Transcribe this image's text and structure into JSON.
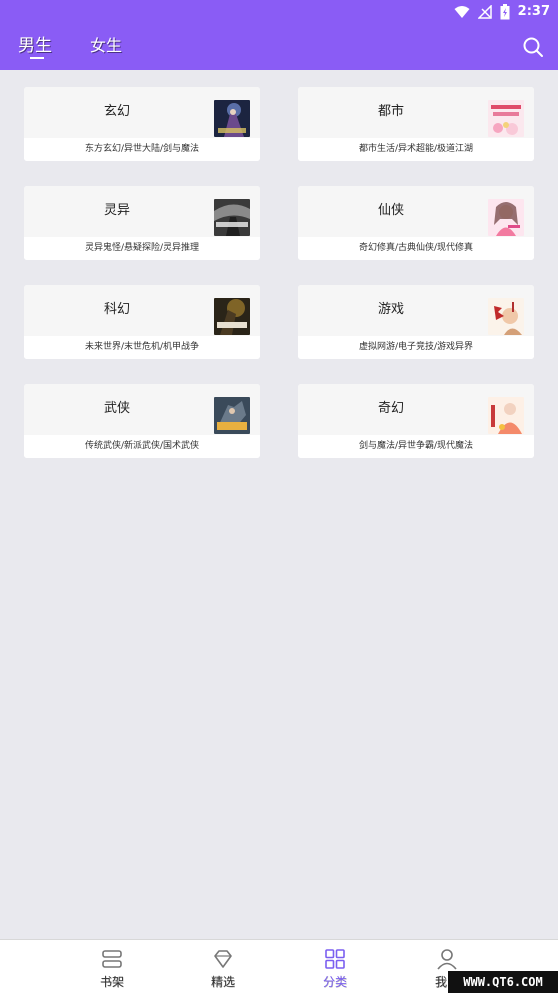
{
  "status_bar": {
    "time": "2:37"
  },
  "header": {
    "tabs": [
      {
        "label": "男生",
        "active": true
      },
      {
        "label": "女生",
        "active": false
      }
    ],
    "accent_color": "#8a5cf5"
  },
  "categories": [
    {
      "title": "玄幻",
      "subtitle": "东方玄幻/异世大陆/剑与魔法"
    },
    {
      "title": "都市",
      "subtitle": "都市生活/异术超能/极道江湖"
    },
    {
      "title": "灵异",
      "subtitle": "灵异鬼怪/悬疑探险/灵异推理"
    },
    {
      "title": "仙侠",
      "subtitle": "奇幻修真/古典仙侠/现代修真"
    },
    {
      "title": "科幻",
      "subtitle": "未来世界/末世危机/机甲战争"
    },
    {
      "title": "游戏",
      "subtitle": "虚拟网游/电子竞技/游戏异界"
    },
    {
      "title": "武侠",
      "subtitle": "传统武侠/新派武侠/国术武侠"
    },
    {
      "title": "奇幻",
      "subtitle": "剑与魔法/异世争霸/现代魔法"
    }
  ],
  "bottom_nav": {
    "items": [
      {
        "label": "书架",
        "icon": "bookshelf-icon"
      },
      {
        "label": "精选",
        "icon": "diamond-icon"
      },
      {
        "label": "分类",
        "icon": "grid-icon",
        "active": true
      },
      {
        "label": "我的",
        "icon": "user-icon"
      }
    ],
    "active_color": "#7b5ff0"
  },
  "watermark": "WWW.QT6.COM"
}
